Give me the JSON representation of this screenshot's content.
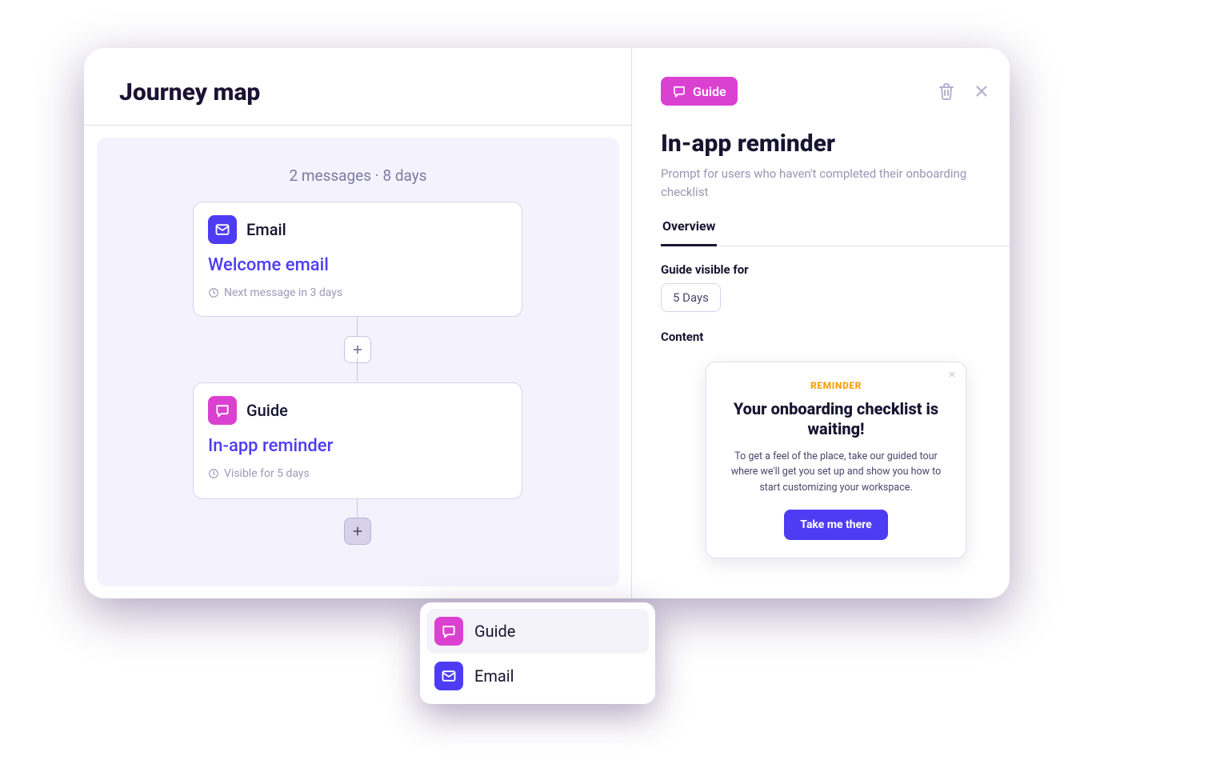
{
  "page": {
    "title": "Journey map"
  },
  "journey": {
    "summary": "2 messages · 8 days",
    "cards": [
      {
        "type_label": "Email",
        "title": "Welcome email",
        "meta": "Next message in 3 days"
      },
      {
        "type_label": "Guide",
        "title": "In-app reminder",
        "meta": "Visible for 5 days"
      }
    ],
    "add_menu": [
      {
        "label": "Guide",
        "kind": "guide"
      },
      {
        "label": "Email",
        "kind": "email"
      }
    ]
  },
  "detail": {
    "chip_label": "Guide",
    "title": "In-app reminder",
    "description": "Prompt for users who haven't completed their onboarding checklist",
    "tabs": [
      "Overview"
    ],
    "visible_for": {
      "label": "Guide visible for",
      "value": "5 Days"
    },
    "content_label": "Content",
    "preview": {
      "eyebrow": "REMINDER",
      "heading": "Your onboarding checklist is waiting!",
      "body": "To get a feel of the place, take our guided tour where we'll get you set up and show you how to start customizing your workspace.",
      "cta": "Take me there"
    }
  },
  "colors": {
    "accent_indigo": "#4e3cf4",
    "accent_magenta": "#db41d1",
    "text_primary": "#171430",
    "text_muted": "#9a96b3",
    "canvas_bg": "#f4f3fd"
  }
}
